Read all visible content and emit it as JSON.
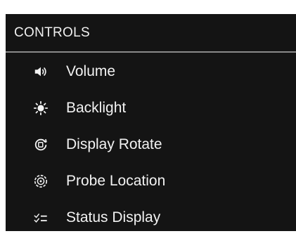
{
  "panel": {
    "title": "CONTROLS"
  },
  "menu": {
    "items": [
      {
        "label": "Volume",
        "icon": "volume-icon"
      },
      {
        "label": "Backlight",
        "icon": "backlight-icon"
      },
      {
        "label": "Display Rotate",
        "icon": "display-rotate-icon"
      },
      {
        "label": "Probe Location",
        "icon": "probe-location-icon"
      },
      {
        "label": "Status Display",
        "icon": "status-display-icon"
      }
    ]
  },
  "colors": {
    "background": "#141414",
    "text": "#f2f2f2",
    "divider": "#8a8a8a"
  }
}
